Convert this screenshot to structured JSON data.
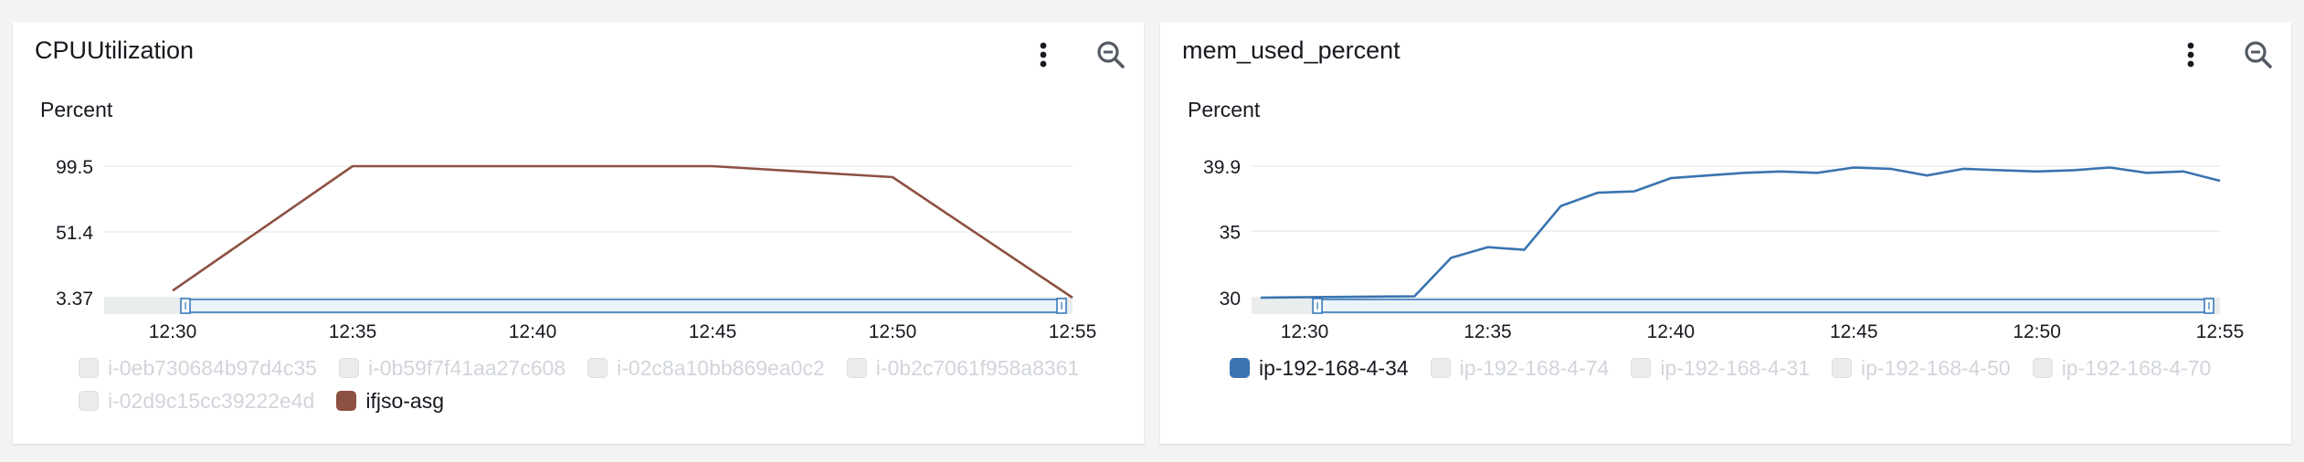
{
  "colors": {
    "cpu_series": "#8c5143",
    "mem_series": "#3a74b0",
    "grid": "#e9ebed",
    "brush_fill": "#ecf3fb",
    "brush_stroke": "#2d72b8",
    "navigator_bg": "#d5dbdb",
    "icon": "#545b64"
  },
  "panels": [
    {
      "title": "CPUUtilization",
      "menu_icon": "kebab-menu-icon",
      "zoom_icon": "zoom-out-icon",
      "legend": [
        {
          "label": "i-0eb730684b97d4c35",
          "active": false
        },
        {
          "label": "i-0b59f7f41aa27c608",
          "active": false
        },
        {
          "label": "i-02c8a10bb869ea0c2",
          "active": false
        },
        {
          "label": "i-0b2c7061f958a8361",
          "active": false
        },
        {
          "label": "i-02d9c15cc39222e4d",
          "active": false
        },
        {
          "label": "ifjso-asg",
          "active": true
        }
      ]
    },
    {
      "title": "mem_used_percent",
      "menu_icon": "kebab-menu-icon",
      "zoom_icon": "zoom-out-icon",
      "legend": [
        {
          "label": "ip-192-168-4-34",
          "active": true
        },
        {
          "label": "ip-192-168-4-74",
          "active": false
        },
        {
          "label": "ip-192-168-4-31",
          "active": false
        },
        {
          "label": "ip-192-168-4-50",
          "active": false
        },
        {
          "label": "ip-192-168-4-70",
          "active": false
        }
      ]
    }
  ],
  "chart_data": [
    {
      "type": "line",
      "title": "CPUUtilization",
      "ylabel": "Percent",
      "ylim": [
        3.37,
        99.5
      ],
      "yticks": [
        "99.5",
        "51.4",
        "3.37"
      ],
      "ytick_values": [
        99.5,
        51.4,
        3.37
      ],
      "xticks": [
        "12:30",
        "12:35",
        "12:40",
        "12:45",
        "12:50",
        "12:55"
      ],
      "xtick_values": [
        0,
        5,
        10,
        15,
        20,
        25
      ],
      "xlim": [
        0,
        25
      ],
      "grid": true,
      "series": [
        {
          "name": "ifjso-asg",
          "x": [
            0,
            5,
            15,
            20,
            25
          ],
          "values": [
            8.5,
            99.5,
            99.5,
            91.5,
            3.37
          ]
        }
      ]
    },
    {
      "type": "line",
      "title": "mem_used_percent",
      "ylabel": "Percent",
      "ylim": [
        30,
        39.9
      ],
      "yticks": [
        "39.9",
        "35",
        "30"
      ],
      "ytick_values": [
        39.9,
        35,
        30
      ],
      "xticks": [
        "12:30",
        "12:35",
        "12:40",
        "12:45",
        "12:50",
        "12:55"
      ],
      "xtick_values": [
        0,
        5,
        10,
        15,
        20,
        25
      ],
      "xlim": [
        -1.2,
        25
      ],
      "grid": true,
      "series": [
        {
          "name": "ip-192-168-4-34",
          "x": [
            -1.2,
            3.0,
            4.0,
            5.0,
            6.0,
            7.0,
            8.0,
            9.0,
            10.0,
            11.0,
            12.0,
            13.0,
            14.0,
            15.0,
            16.0,
            17.0,
            18.0,
            19.0,
            20.0,
            21.0,
            22.0,
            23.0,
            24.0,
            25.0
          ],
          "values": [
            30.0,
            30.1,
            33.0,
            33.8,
            33.6,
            36.9,
            37.9,
            38.0,
            39.0,
            39.2,
            39.4,
            39.5,
            39.4,
            39.8,
            39.7,
            39.2,
            39.7,
            39.6,
            39.5,
            39.6,
            39.8,
            39.4,
            39.5,
            38.8
          ]
        }
      ]
    }
  ]
}
